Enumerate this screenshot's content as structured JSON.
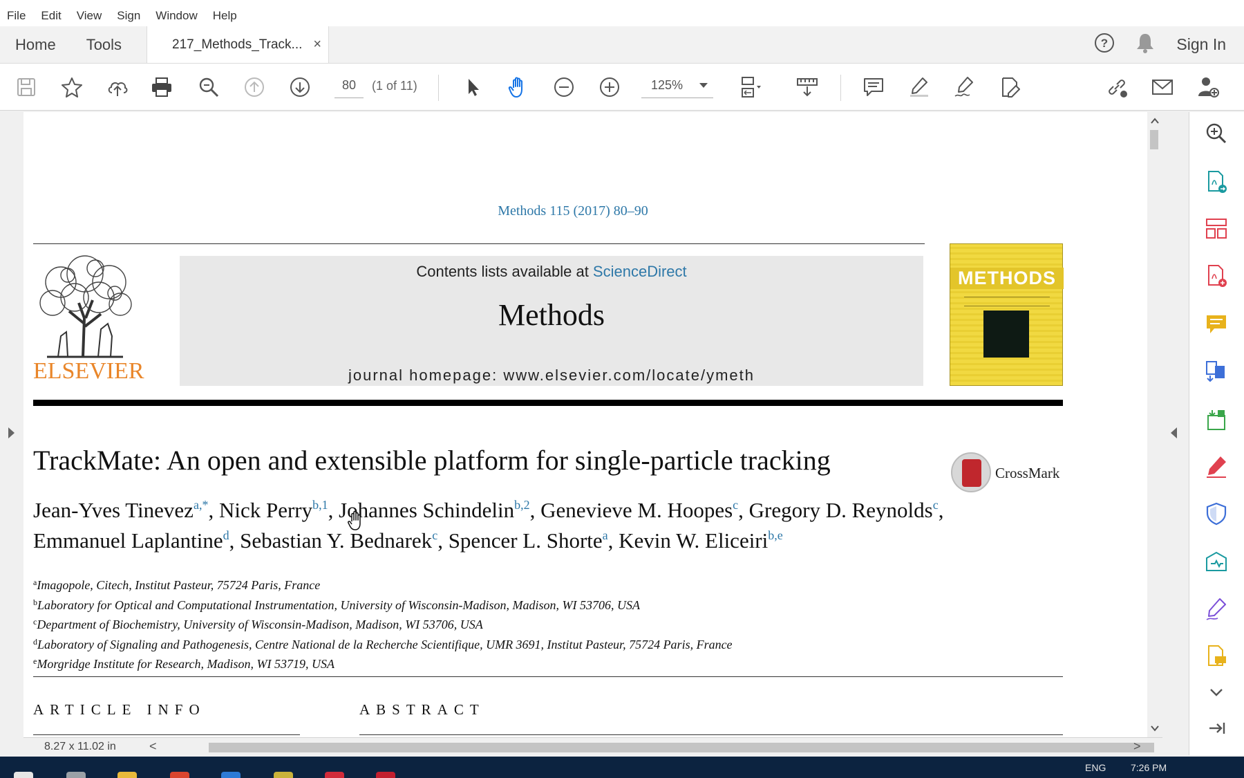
{
  "menu": [
    "File",
    "Edit",
    "View",
    "Sign",
    "Window",
    "Help"
  ],
  "tabs": {
    "home": "Home",
    "tools": "Tools",
    "document": "217_Methods_Track...",
    "close": "×",
    "sign_in": "Sign In"
  },
  "toolbar": {
    "page_number": "80",
    "page_count": "(1 of 11)",
    "zoom": "125%"
  },
  "document": {
    "citation": "Methods 115 (2017) 80–90",
    "contents_prefix": "Contents lists available at ",
    "contents_link": "ScienceDirect",
    "journal": "Methods",
    "homepage": "journal homepage: www.elsevier.com/locate/ymeth",
    "publisher": "ELSEVIER",
    "cover_title": "METHODS",
    "title": "TrackMate: An open and extensible platform for single-particle tracking",
    "crossmark": "CrossMark",
    "authors": [
      {
        "name": "Jean-Yves Tinevez",
        "sup": "a,*",
        "sep": ", "
      },
      {
        "name": "Nick Perry",
        "sup": "b,1",
        "sep": ", "
      },
      {
        "name": "Johannes Schindelin",
        "sup": "b,2",
        "sep": ", "
      },
      {
        "name": "Genevieve M. Hoopes",
        "sup": "c",
        "sep": ", "
      },
      {
        "name": "Gregory D. Reynolds",
        "sup": "c",
        "sep": ","
      },
      {
        "name": "Emmanuel Laplantine",
        "sup": "d",
        "sep": ", "
      },
      {
        "name": "Sebastian Y. Bednarek",
        "sup": "c",
        "sep": ", "
      },
      {
        "name": "Spencer L. Shorte",
        "sup": "a",
        "sep": ", "
      },
      {
        "name": "Kevin W. Eliceiri",
        "sup": "b,e",
        "sep": ""
      }
    ],
    "affiliations": [
      {
        "key": "a",
        "text": "Imagopole, Citech, Institut Pasteur, 75724 Paris, France"
      },
      {
        "key": "b",
        "text": "Laboratory for Optical and Computational Instrumentation, University of Wisconsin-Madison, Madison, WI 53706, USA"
      },
      {
        "key": "c",
        "text": "Department of Biochemistry, University of Wisconsin-Madison, Madison, WI 53706, USA"
      },
      {
        "key": "d",
        "text": "Laboratory of Signaling and Pathogenesis, Centre National de la Recherche Scientifique, UMR 3691, Institut Pasteur, 75724 Paris, France"
      },
      {
        "key": "e",
        "text": "Morgridge Institute for Research, Madison, WI 53719, USA"
      }
    ],
    "article_info": "ARTICLE INFO",
    "abstract": "ABSTRACT"
  },
  "status": {
    "page_size": "8.27 x 11.02 in",
    "scroll_left": "<",
    "scroll_right": ">"
  },
  "taskbar": {
    "lang": "ENG",
    "time": "7:26 PM"
  },
  "colors": {
    "accent_blue": "#2e78a8",
    "tool_teal": "#1a9aa0",
    "elsevier_orange": "#e9862a",
    "tool_red": "#e0414f",
    "tool_yellow": "#e8b21c"
  }
}
